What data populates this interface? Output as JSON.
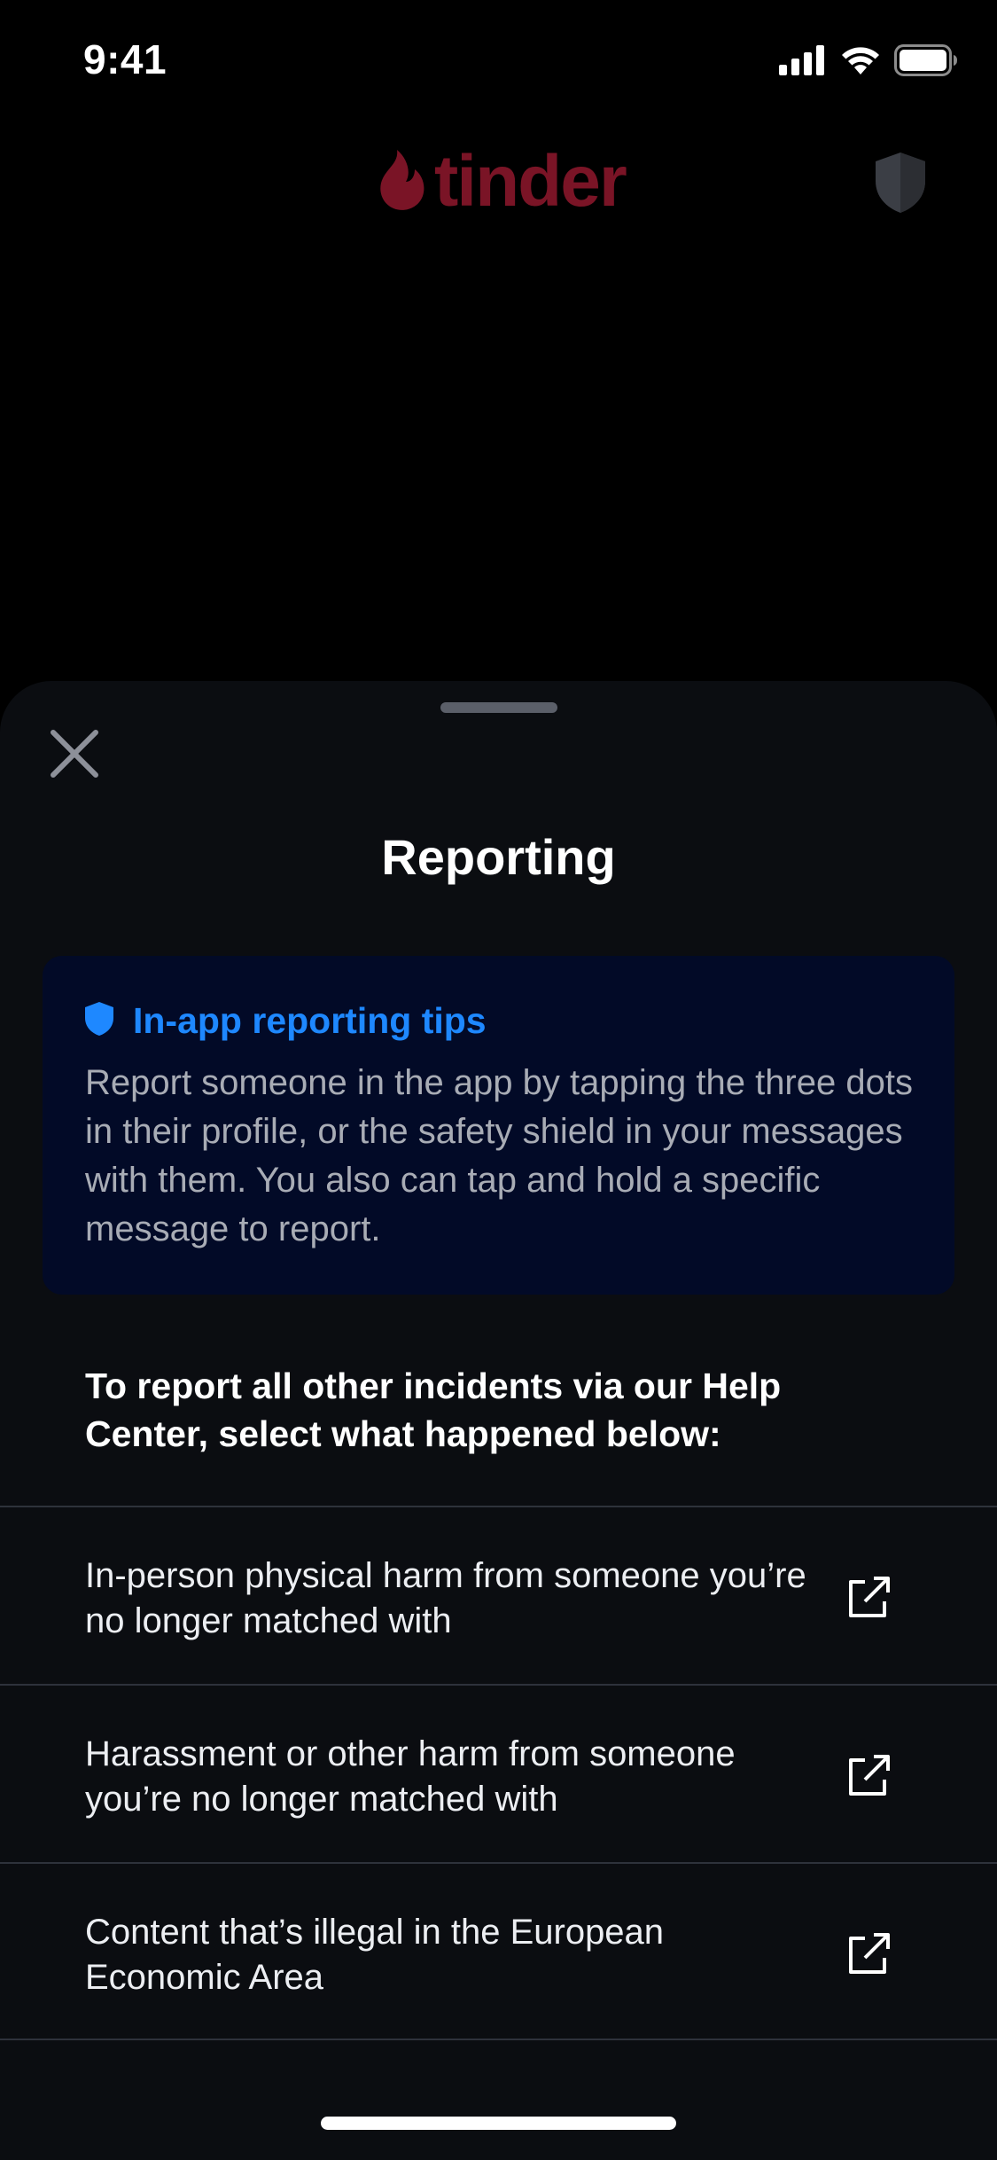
{
  "status_bar": {
    "time": "9:41",
    "icons": [
      "cellular-signal-icon",
      "wifi-icon",
      "battery-icon"
    ]
  },
  "header": {
    "logo_text": "tinder",
    "logo_icon": "flame-icon",
    "shield_icon": "safety-shield-icon",
    "dimmed": true
  },
  "sheet": {
    "title": "Reporting",
    "close_icon": "close-icon",
    "tips": {
      "icon": "shield-icon",
      "heading": "In-app reporting tips",
      "body": "Report someone in the app by tapping the three dots in their profile, or the safety shield in your messages with them. You also can tap and hold a specific message to report."
    },
    "help_intro": "To report all other incidents via our Help Center, select what happened below:",
    "report_options": [
      {
        "label": "In-person physical harm from someone you’re no longer matched with",
        "icon": "external-link-icon"
      },
      {
        "label": "Harassment or other harm from someone you’re no longer matched with",
        "icon": "external-link-icon"
      },
      {
        "label": "Content that’s illegal in the European Economic Area",
        "icon": "external-link-icon"
      }
    ]
  },
  "colors": {
    "background": "#000000",
    "sheet": "#0b0d11",
    "tips_card": "#020a27",
    "accent_blue": "#1e88ff",
    "brand_dimmed": "#7a1426",
    "divider": "#2e323b"
  }
}
